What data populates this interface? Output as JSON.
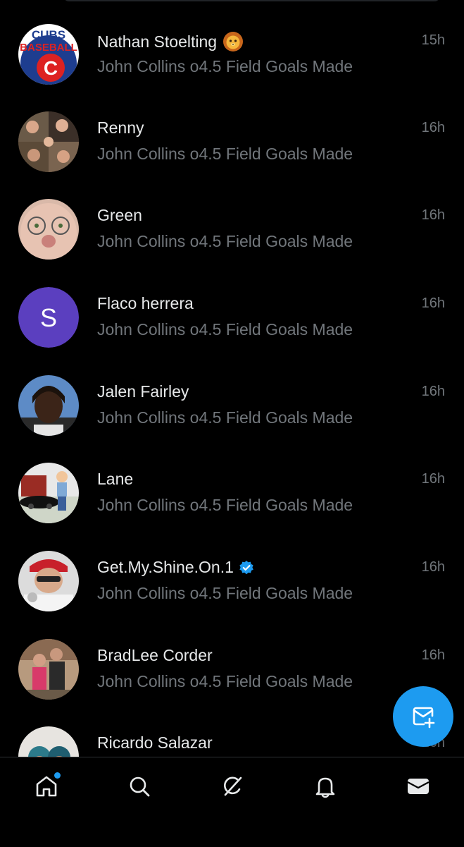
{
  "messages": [
    {
      "name": "Nathan Stoelting",
      "preview": "John Collins o4.5 Field Goals Made",
      "time": "15h",
      "avatar_text": "CUBS",
      "avatar_text2": "BASEBALL",
      "avatar_letter": "C",
      "emoji": "lion-emoji"
    },
    {
      "name": "Renny",
      "preview": "John Collins o4.5 Field Goals Made",
      "time": "16h"
    },
    {
      "name": "Green",
      "preview": "John Collins o4.5 Field Goals Made",
      "time": "16h"
    },
    {
      "name": "Flaco herrera",
      "preview": "John Collins o4.5 Field Goals Made",
      "time": "16h",
      "avatar_letter": "S"
    },
    {
      "name": "Jalen Fairley",
      "preview": "John Collins o4.5 Field Goals Made",
      "time": "16h"
    },
    {
      "name": "Lane",
      "preview": "John Collins o4.5 Field Goals Made",
      "time": "16h"
    },
    {
      "name": "Get.My.Shine.On.1",
      "preview": "John Collins o4.5 Field Goals Made",
      "time": "16h",
      "verified": true
    },
    {
      "name": "BradLee Corder",
      "preview": "John Collins o4.5 Field Goals Made",
      "time": "16h"
    },
    {
      "name": "Ricardo Salazar",
      "preview": "",
      "time": "16h"
    }
  ],
  "tabs": [
    "home-icon",
    "search-icon",
    "grok-icon",
    "notifications-icon",
    "messages-icon"
  ],
  "colors": {
    "accent": "#1d9bf0",
    "secondary_text": "#71767b",
    "primary_text": "#e7e9ea",
    "purple_avatar": "#5b3fbf"
  }
}
